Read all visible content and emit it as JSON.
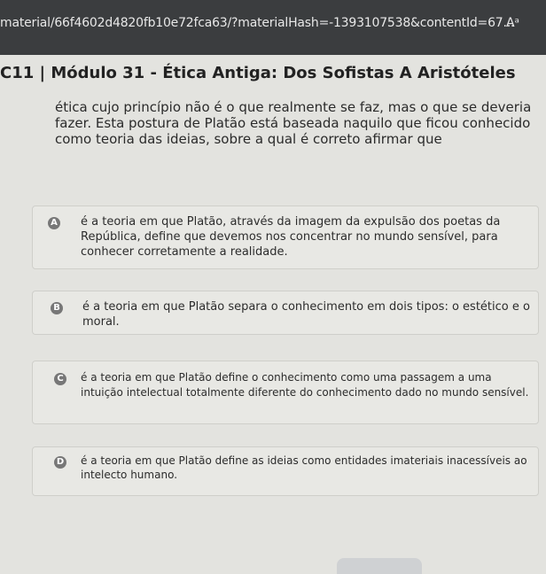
{
  "browser": {
    "url": "material/66f4602d4820fb10e72fca63/?materialHash=-1393107538&contentId=67...",
    "font_icon_label": "Aᵃ"
  },
  "page": {
    "title": "C11 | Módulo 31 - Ética Antiga: Dos Sofistas A Aristóteles",
    "statement": "ética cujo princípio não é o que realmente se faz, mas o que se deveria fazer. Esta postura de Platão está baseada naquilo que ficou conhecido como teoria das ideias, sobre a qual é correto afirmar que"
  },
  "options": [
    {
      "letter": "A",
      "text": "é a teoria em que Platão, através da imagem da expulsão dos poetas da República, define que devemos nos concentrar no mundo sensível, para conhecer corretamente a realidade."
    },
    {
      "letter": "B",
      "text": "é a teoria em que Platão separa o conhecimento em dois tipos: o estético e o moral."
    },
    {
      "letter": "C",
      "text": "é a teoria em que Platão define o conhecimento como uma passagem a uma intuição intelectual totalmente diferente do conhecimento dado no mundo sensível."
    },
    {
      "letter": "D",
      "text": "é a teoria em que Platão define as ideias como entidades imateriais inacessíveis ao intelecto humano."
    }
  ],
  "colors": {
    "url_bar": "#3b3d3f",
    "page_background": "#e3e3df",
    "badge": "#777777"
  }
}
